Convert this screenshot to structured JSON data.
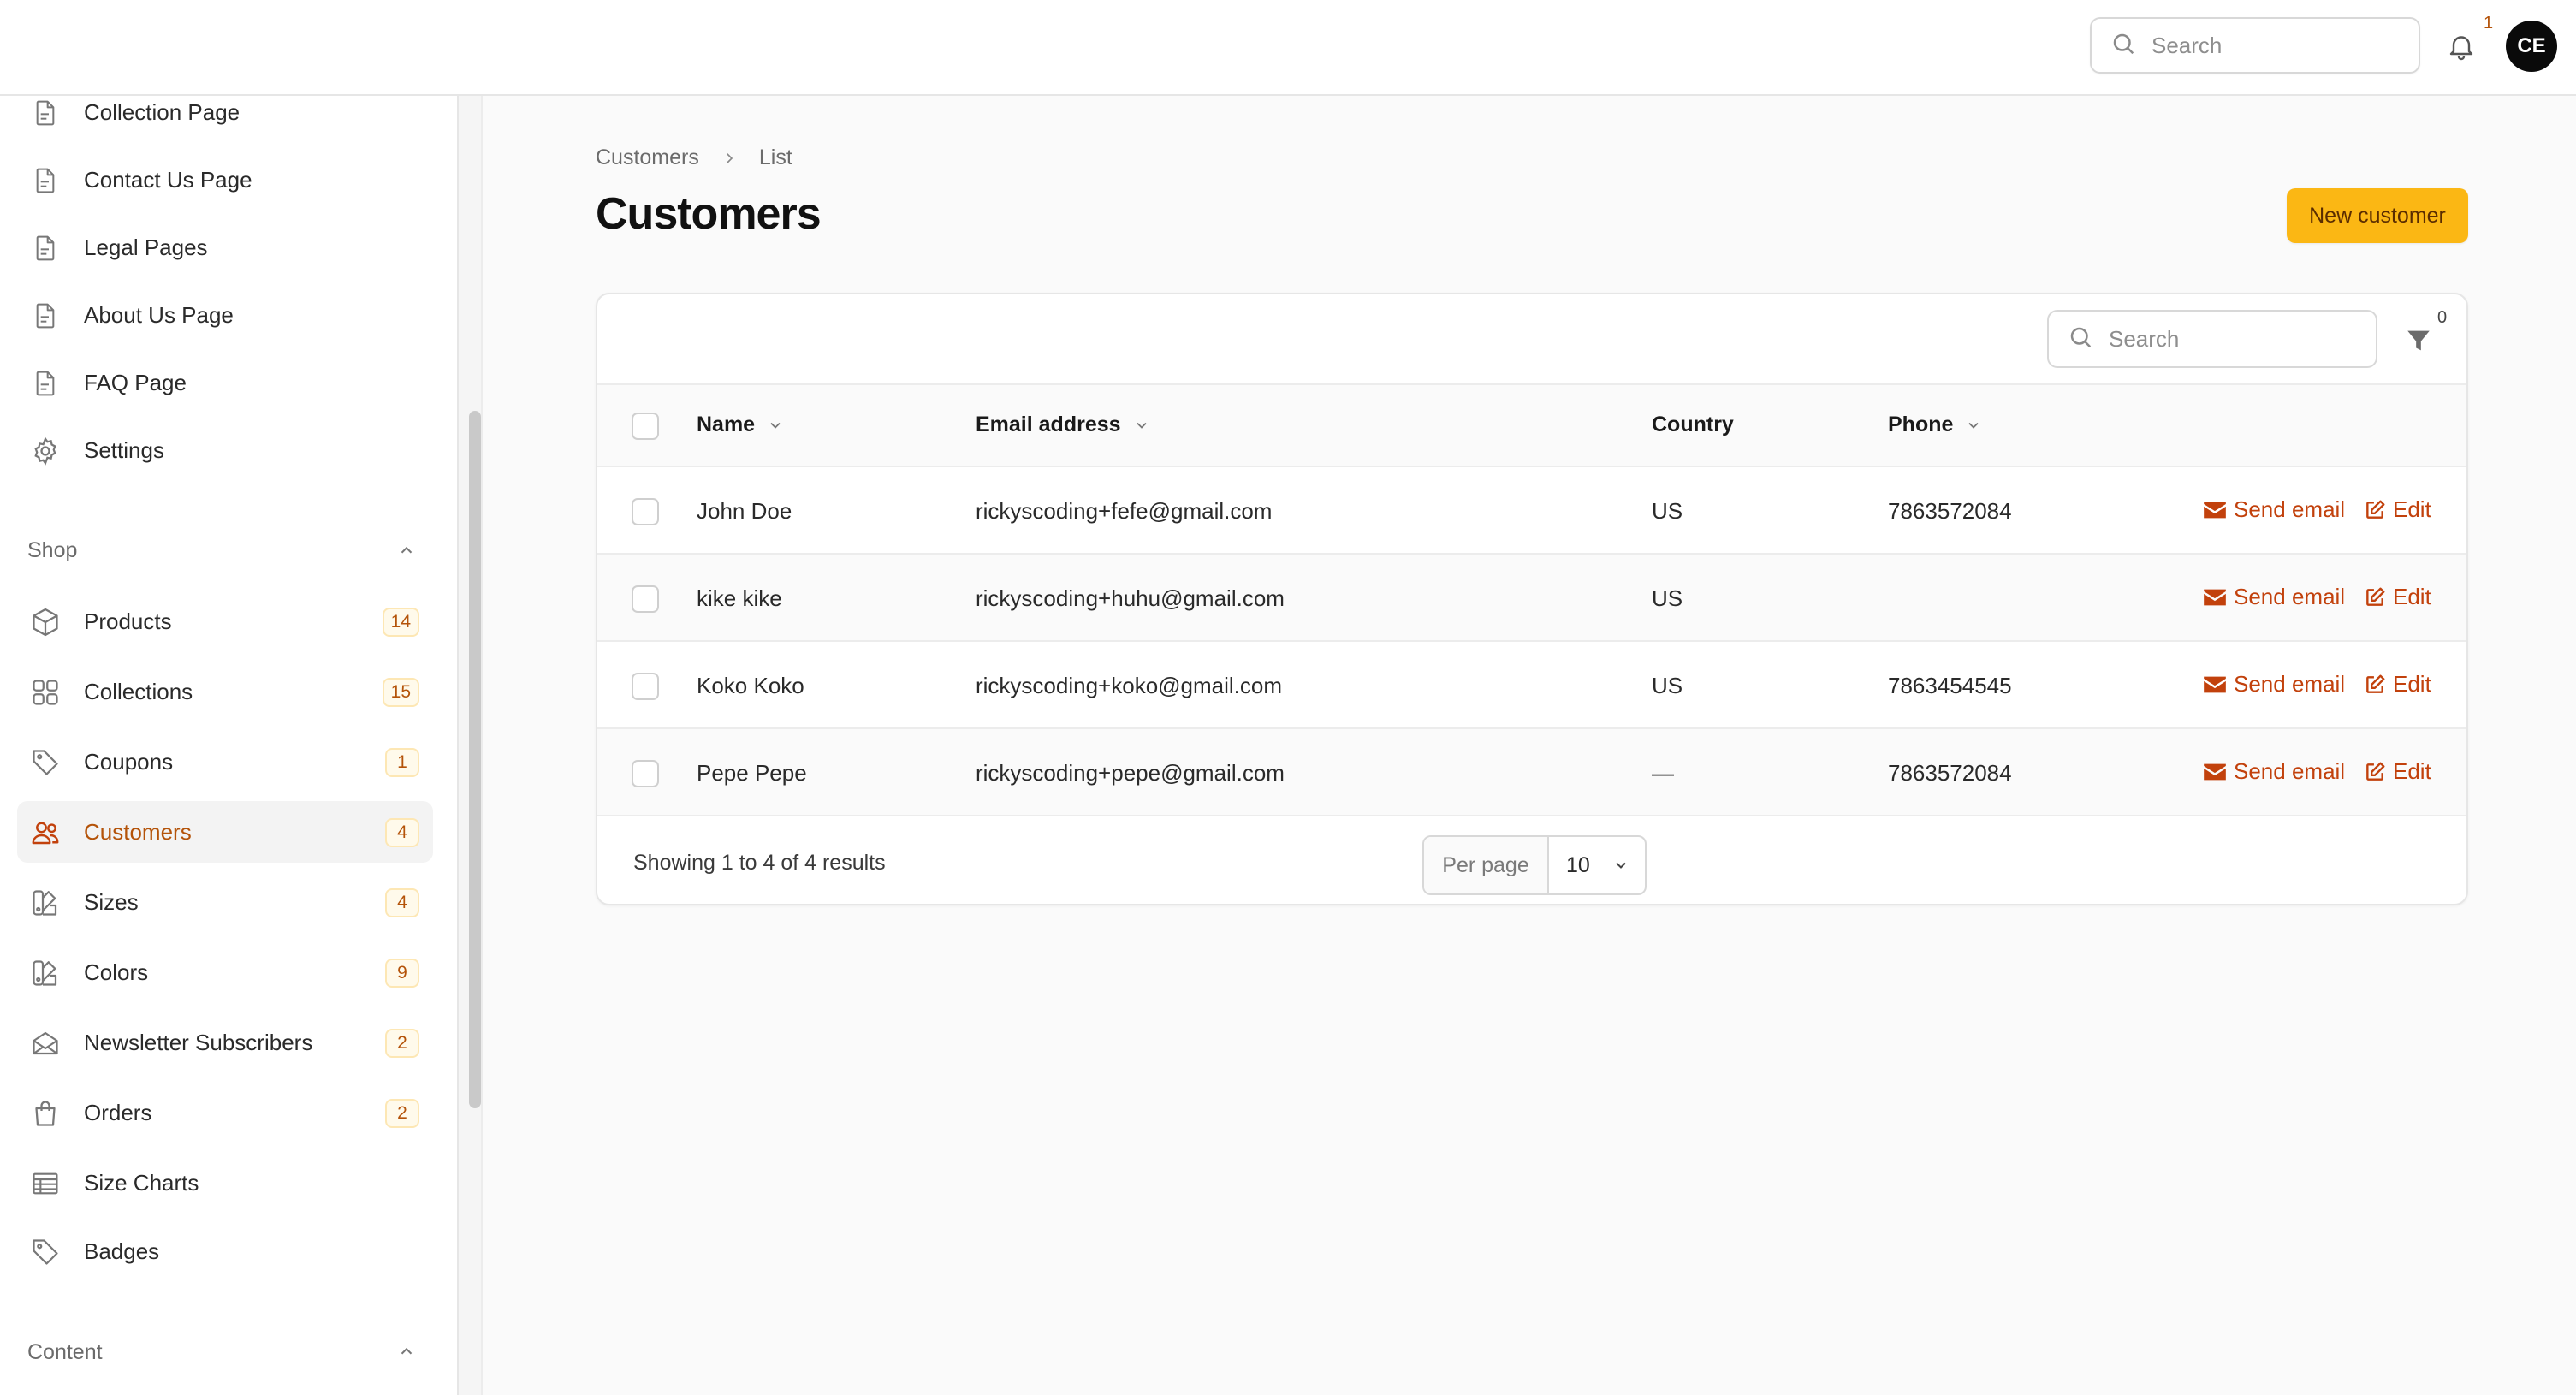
{
  "topbar": {
    "search_placeholder": "Search",
    "notification_count": "1",
    "avatar_initials": "CE"
  },
  "sidebar": {
    "pages_items": [
      {
        "label": "Collection Page",
        "icon": "document-icon"
      },
      {
        "label": "Contact Us Page",
        "icon": "document-icon"
      },
      {
        "label": "Legal Pages",
        "icon": "document-icon"
      },
      {
        "label": "About Us Page",
        "icon": "document-icon"
      },
      {
        "label": "FAQ Page",
        "icon": "document-icon"
      },
      {
        "label": "Settings",
        "icon": "gear-icon"
      }
    ],
    "shop_group_label": "Shop",
    "shop_items": [
      {
        "label": "Products",
        "badge": "14",
        "icon": "cube-icon"
      },
      {
        "label": "Collections",
        "badge": "15",
        "icon": "grid-icon"
      },
      {
        "label": "Coupons",
        "badge": "1",
        "icon": "tag-icon"
      },
      {
        "label": "Customers",
        "badge": "4",
        "icon": "users-icon",
        "active": true
      },
      {
        "label": "Sizes",
        "badge": "4",
        "icon": "swatch-icon"
      },
      {
        "label": "Colors",
        "badge": "9",
        "icon": "swatch-icon"
      },
      {
        "label": "Newsletter Subscribers",
        "badge": "2",
        "icon": "envelope-open-icon"
      },
      {
        "label": "Orders",
        "badge": "2",
        "icon": "shopping-bag-icon"
      },
      {
        "label": "Size Charts",
        "badge": "",
        "icon": "table-icon"
      },
      {
        "label": "Badges",
        "badge": "",
        "icon": "tag-icon"
      }
    ],
    "content_group_label": "Content"
  },
  "breadcrumb": {
    "items": [
      "Customers",
      "List"
    ]
  },
  "page": {
    "title": "Customers",
    "new_button_label": "New customer"
  },
  "table": {
    "search_placeholder": "Search",
    "filter_count": "0",
    "columns": {
      "name": "Name",
      "email": "Email address",
      "country": "Country",
      "phone": "Phone"
    },
    "rows": [
      {
        "name": "John Doe",
        "email": "rickyscoding+fefe@gmail.com",
        "country": "US",
        "phone": "7863572084"
      },
      {
        "name": "kike kike",
        "email": "rickyscoding+huhu@gmail.com",
        "country": "US",
        "phone": ""
      },
      {
        "name": "Koko Koko",
        "email": "rickyscoding+koko@gmail.com",
        "country": "US",
        "phone": "7863454545"
      },
      {
        "name": "Pepe Pepe",
        "email": "rickyscoding+pepe@gmail.com",
        "country": "—",
        "phone": "7863572084"
      }
    ],
    "action_send_email": "Send email",
    "action_edit": "Edit",
    "footer": {
      "showing_text": "Showing 1 to 4 of 4 results",
      "per_page_label": "Per page",
      "per_page_value": "10"
    }
  },
  "colors": {
    "accent": "#c2410c",
    "primary_button": "#fbb714",
    "badge_text": "#b45309"
  }
}
